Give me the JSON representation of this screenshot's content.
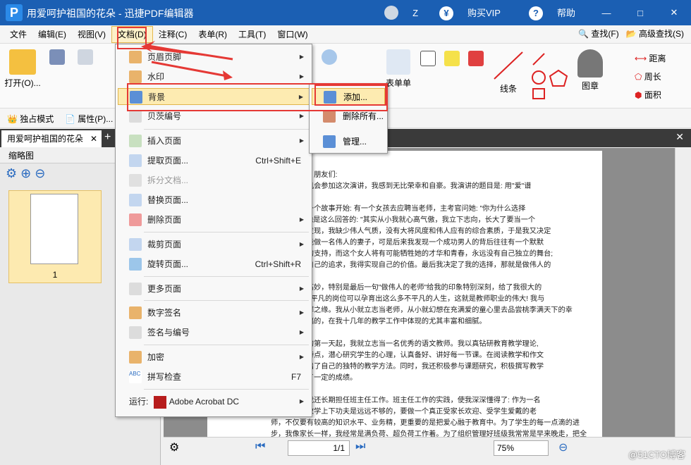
{
  "window": {
    "title": "用爱呵护祖国的花朵 - 迅捷PDF编辑器",
    "z_label": "Z",
    "buy_vip": "购买VIP",
    "help": "帮助",
    "logo": "P"
  },
  "menubar": {
    "items": [
      "文件",
      "编辑(E)",
      "视图(V)",
      "文档(D)",
      "注释(C)",
      "表单(R)",
      "工具(T)",
      "窗口(W)"
    ],
    "find": "查找(F)",
    "adv_find": "高级查找(S)"
  },
  "ribbon": {
    "open": "打开(O)...",
    "line": "线条",
    "stamp": "图章",
    "form": "表单单",
    "distance": "距离",
    "perimeter": "周长",
    "area": "面积"
  },
  "toolbar2": {
    "solo": "独占模式",
    "props": "属性(P)..."
  },
  "tab": {
    "doc_name": "用爱呵护祖国的花朵"
  },
  "panel": {
    "title": "缩略图",
    "thumb_label": "1"
  },
  "doc_menu": {
    "header_footer": "页眉页脚",
    "watermark": "水印",
    "background": "背景",
    "bates": "贝茨编号",
    "insert": "插入页面",
    "extract": "提取页面...",
    "extract_sc": "Ctrl+Shift+E",
    "split": "拆分文档...",
    "replace": "替换页面...",
    "delete": "删除页面",
    "crop": "裁剪页面",
    "rotate": "旋转页面...",
    "rotate_sc": "Ctrl+Shift+R",
    "more": "更多页面",
    "digital_sign": "数字签名",
    "sign_num": "签名与编号",
    "encrypt": "加密",
    "spell": "拼写检查",
    "spell_sc": "F7",
    "run_label": "运行:",
    "run_app": "Adobe Acrobat DC"
  },
  "bg_submenu": {
    "add": "添加...",
    "remove_all": "删除所有...",
    "manage": "管理..."
  },
  "document_lines": [
    "亲爱的领导、朋友们:",
    "今天，能有机会参加这次演讲，我感到无比荣幸和自豪。我演讲的题目是: 用\"爱\"谱",
    "",
    "首先我想从一个故事开始: 有一个女孩去应聘当老师，主考官问她: \"你为什么选择",
    "这个职业?\"她是这么回答的: \"其实从小我就心高气傲，我立下志向，长大了要当一个",
    "的人。后来发现，我缺少伟人气质，没有大将风度和伟人应有的综合素质，于是我又决定",
    "人。我希望能做一名伟人的妻子，可是后来我发现一个成功男人的背后往往有一个默默",
    "奉献的女人的支持，而这个女人将有可能牺牲她的才华和青春，永远没有自己独立的舞台;",
    "我不能放弃自己的追求，我得实现自己的价值。最后我决定了我的选择，那就是做伟人的",
    "",
    "故事讲得很高妙，特别是最后一句\"做伟人的老师\"给我的印象特别深刻，给了我很大的",
    "启示: 在这个平凡的岗位可以孕育出这么多不平凡的人生，这就是教师职业的伟大! 我与",
    "教师结下不解之缘。我从小就立志当老师，从小就幻想在充满爱的童心里去品尝桃李满天下的幸",
    "福。我是幸福的，在我十几年的教学工作中体现的尤其丰富和细腻。",
    "",
    "从走上讲台的第一天起，我就立志当一名优秀的语文教师。我以真钻研教育教学理论,",
    "根据学生的特点，潜心研究学生的心理，认真备好、讲好每一节课。在阅读教学和作文",
    "教学中总结出了自己的独特的教学方法。同时，我还积极参与课题研究，积极撰写教学",
    "论文，取得了一定的成绩。",
    "",
    "工作以来，我还长期担任班主任工作。班主任工作的实践，使我深深懂得了: 作为一名",
    "教师，光在教学上下功夫是远远不够的，要做一个真正受家长欢迎、受学生爱戴的老",
    "师，不仅要有较高的知识水平、业务精，更重要的是把爱心融于教育中。为了学生的每一点滴的进",
    "步，我像家长一样，我经常是满负荷、超负荷工作着。为了组织管理好班级我常常是早来晚走，把全",
    "部心思都用在了学生身上。为了了解学生的情况，暑假里，我冒着炎炎烈日逐一走访每名学",
    "生，及时掌握他们的思想变化，对学生真正做到了学习上关心、生活上照顾、心灵上沟通。"
  ],
  "status": {
    "page": "1/1",
    "zoom": "75%"
  },
  "watermark": "@51CTO博客"
}
